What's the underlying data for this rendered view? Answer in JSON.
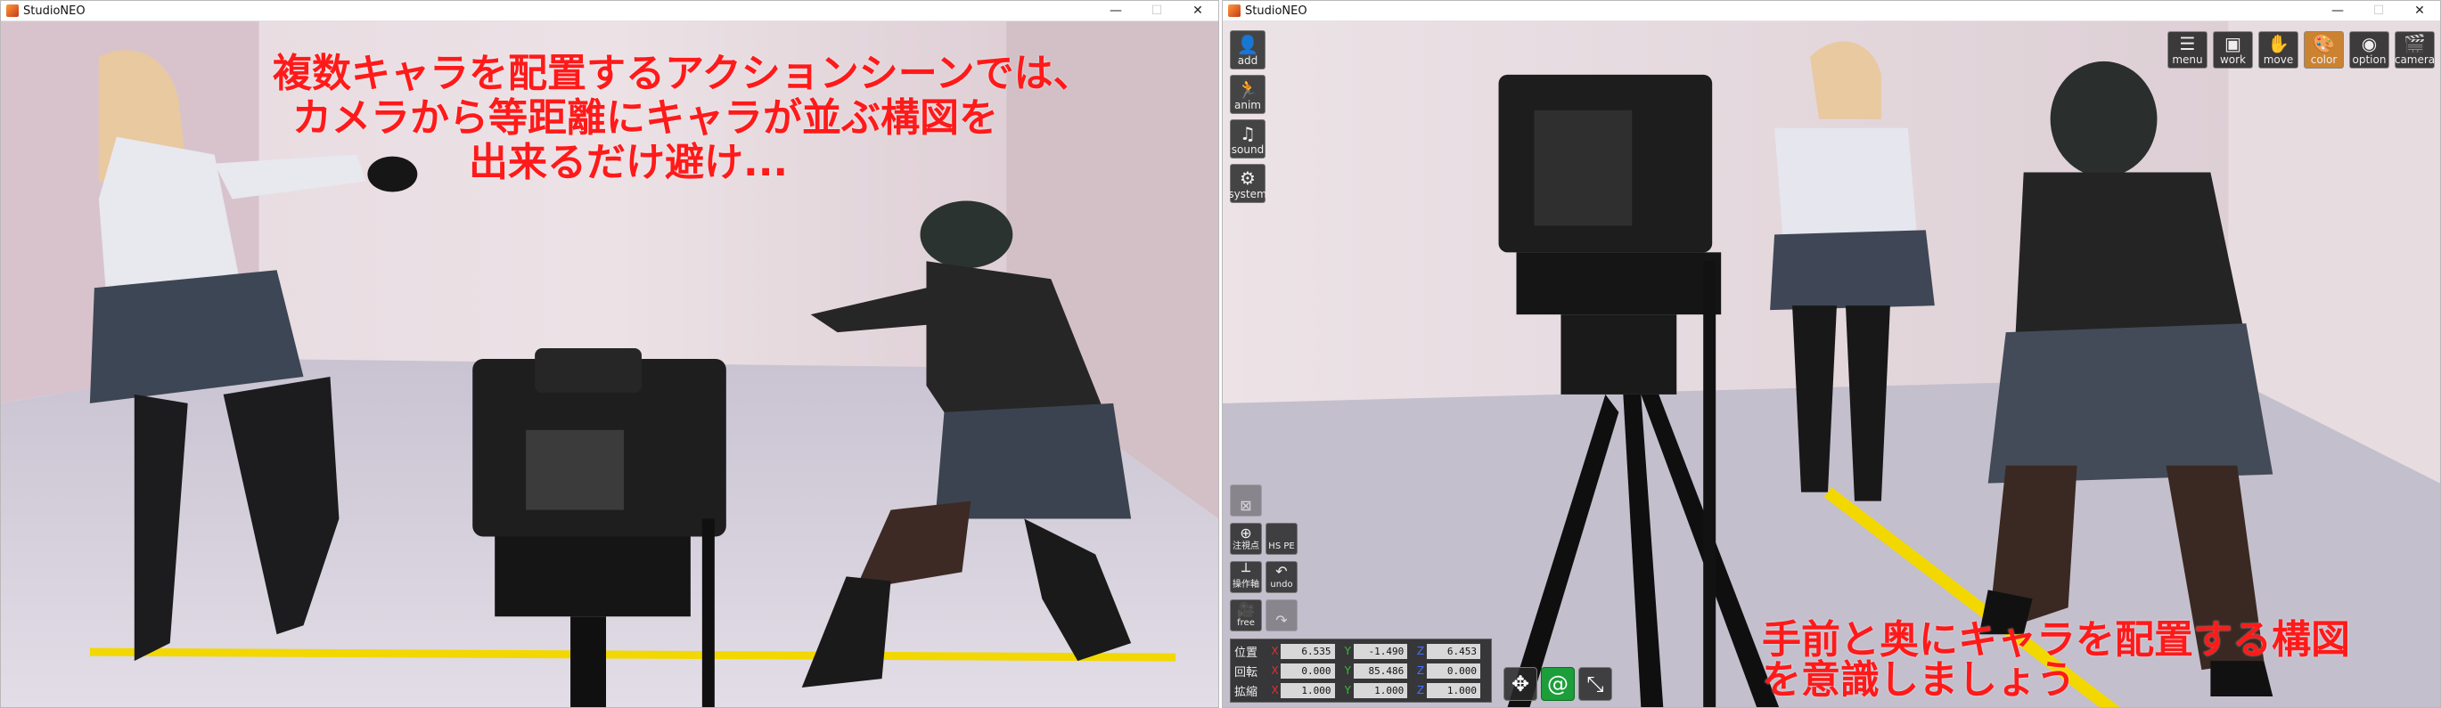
{
  "windows": {
    "left": {
      "title": "StudioNEO",
      "min": "—",
      "max": "☐",
      "close": "✕"
    },
    "right": {
      "title": "StudioNEO",
      "min": "—",
      "max": "☐",
      "close": "✕"
    }
  },
  "captions": {
    "left": [
      "複数キャラを配置するアクションシーンでは、",
      "カメラから等距離にキャラが並ぶ構図を",
      "出来るだけ避け..."
    ],
    "right": [
      "手前と奥にキャラを配置する構図",
      "を意識しましょう"
    ]
  },
  "sidebar": [
    {
      "label": "add",
      "icon": "person-add-icon",
      "glyph": "👤"
    },
    {
      "label": "anim",
      "icon": "running-figure-icon",
      "glyph": "🏃"
    },
    {
      "label": "sound",
      "icon": "music-note-icon",
      "glyph": "♫"
    },
    {
      "label": "system",
      "icon": "gears-icon",
      "glyph": "⚙"
    }
  ],
  "topbar": [
    {
      "label": "menu",
      "icon": "list-icon",
      "glyph": "☰"
    },
    {
      "label": "work",
      "icon": "work-square-icon",
      "glyph": "▣"
    },
    {
      "label": "move",
      "icon": "hand-icon",
      "glyph": "✋"
    },
    {
      "label": "color",
      "icon": "palette-icon",
      "glyph": "🎨"
    },
    {
      "label": "option",
      "icon": "eye-icon",
      "glyph": "◉"
    },
    {
      "label": "camera",
      "icon": "clapperboard-icon",
      "glyph": "🎬"
    }
  ],
  "lower_tools": [
    {
      "label": "",
      "icon": "map-icon",
      "glyph": "⊠",
      "dim": true
    },
    {
      "label": "注視点",
      "icon": "target-plus-icon",
      "glyph": "⊕"
    },
    {
      "label": "HS PE",
      "icon": "hspe-icon",
      "glyph": ""
    },
    {
      "label": "操作軸",
      "icon": "axis-icon",
      "glyph": "┴"
    },
    {
      "label": "undo",
      "icon": "undo-icon",
      "glyph": "↶"
    },
    {
      "label": "free",
      "icon": "camera-free-icon",
      "glyph": "🎥"
    },
    {
      "label": "",
      "icon": "redo-icon",
      "glyph": "↷",
      "dim": true
    }
  ],
  "coords": {
    "position": {
      "label": "位置",
      "x": "6.535",
      "y": "-1.490",
      "z": "6.453"
    },
    "rotation": {
      "label": "回転",
      "x": "0.000",
      "y": "85.486",
      "z": "0.000"
    },
    "scale": {
      "label": "拡縮",
      "x": "1.000",
      "y": "1.000",
      "z": "1.000"
    },
    "axes": {
      "x": "X",
      "y": "Y",
      "z": "Z"
    }
  },
  "mode_buttons": [
    {
      "icon": "move-arrows-icon",
      "glyph": "✥"
    },
    {
      "icon": "rotate-icon",
      "glyph": "@"
    },
    {
      "icon": "scale-icon",
      "glyph": "⤡"
    }
  ],
  "colors": {
    "caption": "#ff1a1a",
    "guide_line": "#f2d800"
  }
}
